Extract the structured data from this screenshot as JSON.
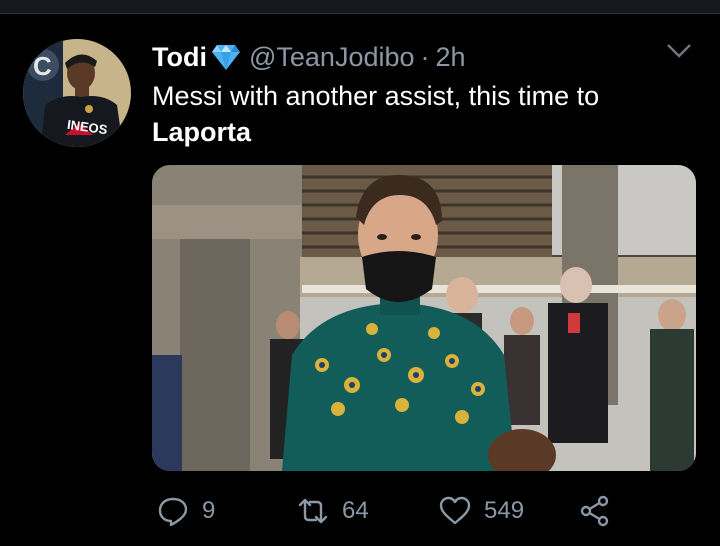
{
  "tweet": {
    "author_name": "Todi",
    "handle": "@TeanJodibo",
    "separator": "·",
    "time": "2h",
    "text_line1": "Messi with another assist, this time to",
    "text_line2": "Laporta",
    "media_alt_icon": "photo",
    "avatar_jersey_text": "INEOS"
  },
  "actions": {
    "reply_count": "9",
    "retweet_count": "64",
    "like_count": "549"
  },
  "colors": {
    "background": "#000000",
    "secondary_text": "#8b98a5",
    "verified": "#4ab3f4"
  }
}
